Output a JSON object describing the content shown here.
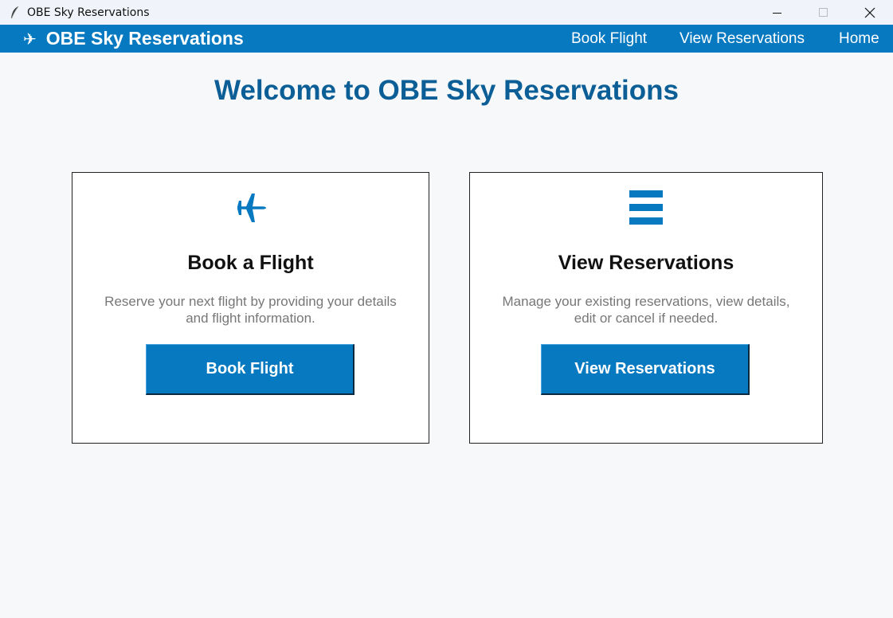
{
  "window": {
    "title": "OBE Sky Reservations",
    "controls": [
      "minimize-icon",
      "maximize-icon",
      "close-icon"
    ]
  },
  "navbar": {
    "brand_icon": "✈",
    "brand": "OBE Sky Reservations",
    "links": [
      {
        "label": "Book Flight"
      },
      {
        "label": "View Reservations"
      },
      {
        "label": "Home"
      }
    ],
    "color": "#0679c1"
  },
  "main": {
    "welcome": "Welcome to OBE Sky Reservations",
    "cards": [
      {
        "icon": "airplane-icon",
        "title": "Book a Flight",
        "desc_line1": "Reserve your next flight by providing your details",
        "desc_line2": "and flight information.",
        "button": "Book Flight"
      },
      {
        "icon": "list-icon",
        "title": "View Reservations",
        "desc_line1": "Manage your existing reservations, view details,",
        "desc_line2": "edit or cancel if needed.",
        "button": "View Reservations"
      }
    ]
  },
  "colors": {
    "accent": "#0679c1",
    "heading": "#0c5f96",
    "background": "#f6f8fa"
  }
}
